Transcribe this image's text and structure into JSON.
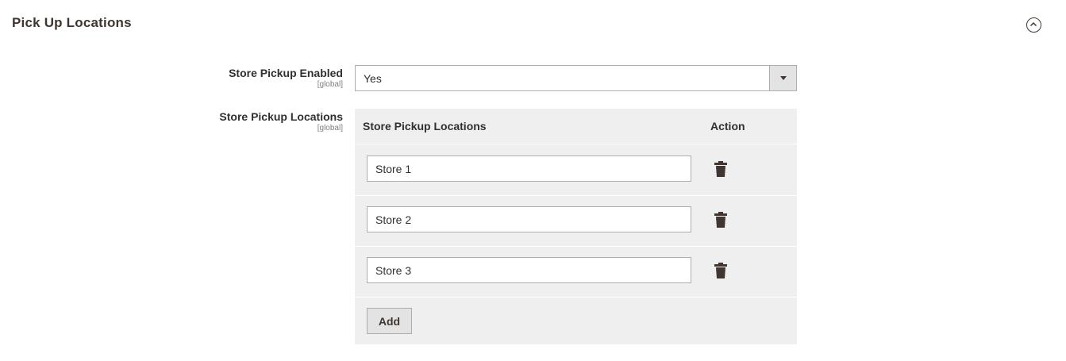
{
  "section": {
    "title": "Pick Up Locations"
  },
  "fields": {
    "enabled": {
      "label": "Store Pickup Enabled",
      "scope": "[global]",
      "value": "Yes"
    },
    "locations": {
      "label": "Store Pickup Locations",
      "scope": "[global]"
    }
  },
  "grid": {
    "headers": [
      "Store Pickup Locations",
      "Action"
    ],
    "rows": [
      "Store 1",
      "Store 2",
      "Store 3"
    ],
    "add_label": "Add"
  },
  "icons": {
    "collapse": "chevron-up-circle-icon",
    "delete": "trash-icon"
  }
}
